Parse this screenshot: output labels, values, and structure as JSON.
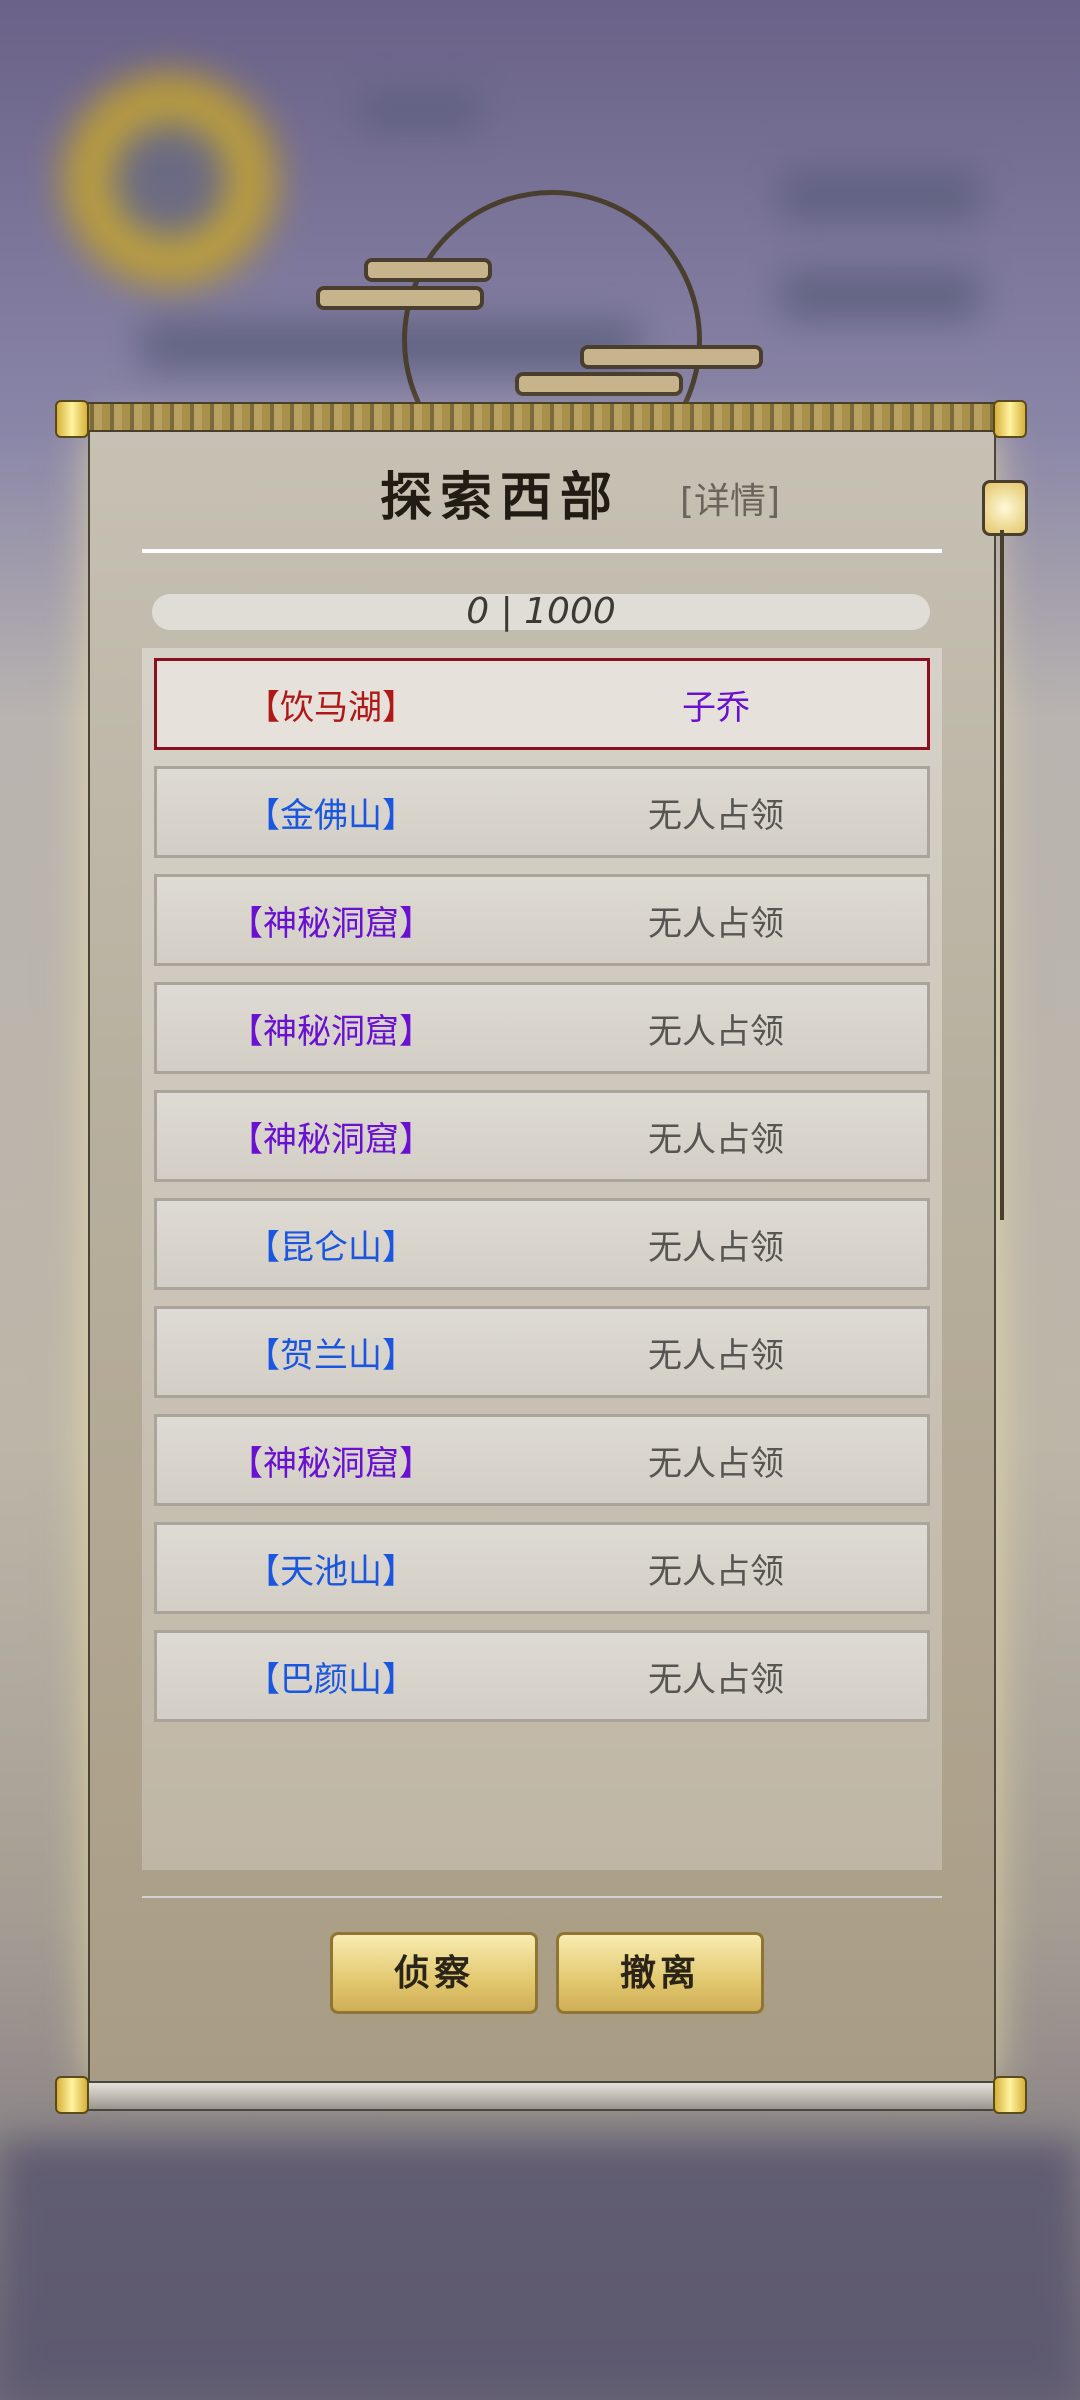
{
  "header": {
    "title": "探索西部",
    "detail_link": "[详情]"
  },
  "progress": {
    "text": "0 | 1000",
    "current": 0,
    "max": 1000
  },
  "territories": [
    {
      "name": "【饮马湖】",
      "owner": "子乔",
      "name_color": "#b01818",
      "selected": true
    },
    {
      "name": "【金佛山】",
      "owner": "无人占领",
      "name_color": "#1a56e0",
      "selected": false
    },
    {
      "name": "【神秘洞窟】",
      "owner": "无人占领",
      "name_color": "#6a10d0",
      "selected": false
    },
    {
      "name": "【神秘洞窟】",
      "owner": "无人占领",
      "name_color": "#6a10d0",
      "selected": false
    },
    {
      "name": "【神秘洞窟】",
      "owner": "无人占领",
      "name_color": "#6a10d0",
      "selected": false
    },
    {
      "name": "【昆仑山】",
      "owner": "无人占领",
      "name_color": "#1a56e0",
      "selected": false
    },
    {
      "name": "【贺兰山】",
      "owner": "无人占领",
      "name_color": "#1a56e0",
      "selected": false
    },
    {
      "name": "【神秘洞窟】",
      "owner": "无人占领",
      "name_color": "#6a10d0",
      "selected": false
    },
    {
      "name": "【天池山】",
      "owner": "无人占领",
      "name_color": "#1a56e0",
      "selected": false
    },
    {
      "name": "【巴颜山】",
      "owner": "无人占领",
      "name_color": "#1a56e0",
      "selected": false
    }
  ],
  "buttons": {
    "scout": "侦察",
    "withdraw": "撤离"
  },
  "icons": {
    "lantern": "lantern-icon",
    "moon": "moon-decoration"
  }
}
